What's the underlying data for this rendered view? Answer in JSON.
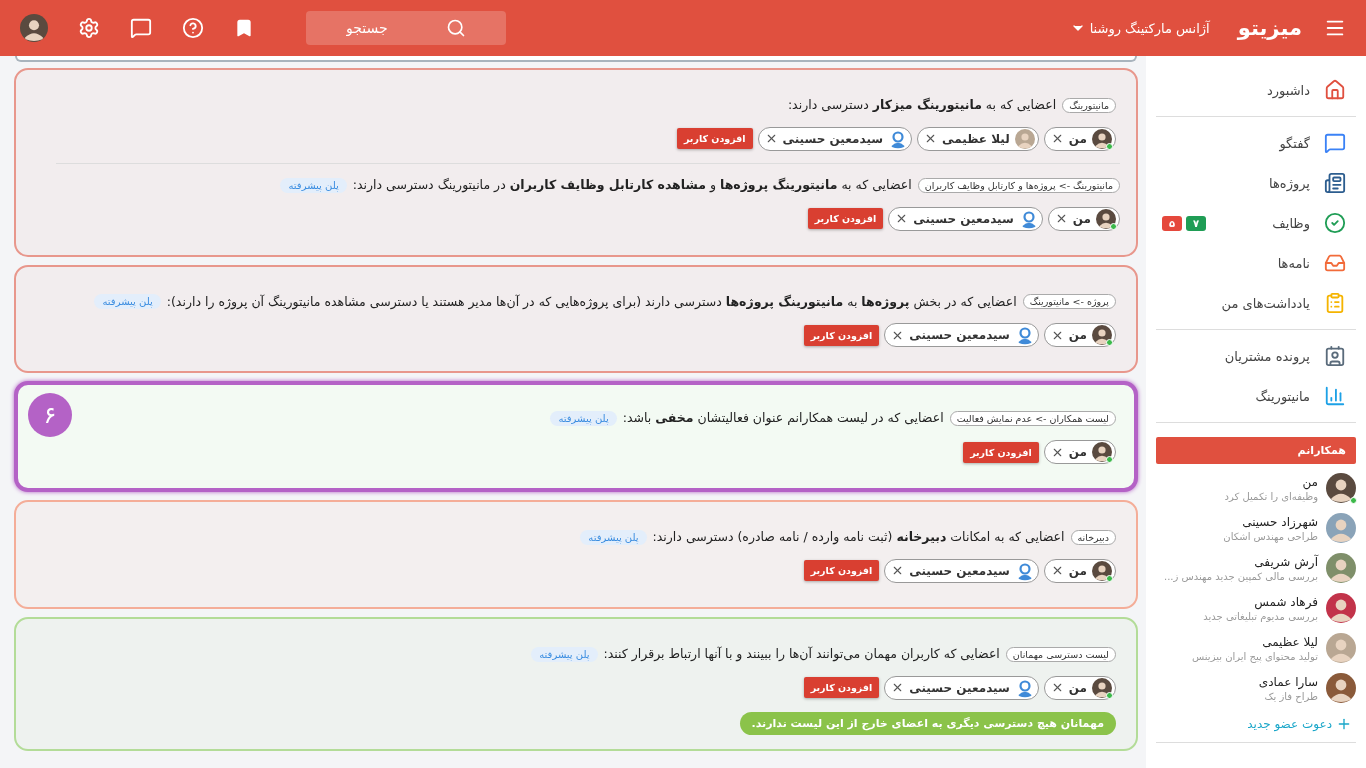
{
  "header": {
    "logo": "میزیتو",
    "workspace": "آژانس مارکتینگ روشنا",
    "search": {
      "placeholder": "جستجو"
    }
  },
  "cards": [
    {
      "color": "#e8978c",
      "selected": false,
      "sections": [
        {
          "tag": "مانیتورینگ",
          "text": "اعضایی که به **مانیتورینگ میزکار** دسترسی دارند:",
          "members": [
            {
              "name": "من",
              "kind": "photo",
              "online": true
            },
            {
              "name": "لیلا عظیمی",
              "kind": "photo",
              "online": false
            },
            {
              "name": "سیدمعین حسینی",
              "kind": "default",
              "online": false
            }
          ],
          "add": "افزودن کاربر"
        },
        {
          "tag": "مانیتورینگ -> پروژه‌ها و کارتابل وظایف کاربران",
          "text": "اعضایی که به **مانیتورینگ پروژه‌ها** و **مشاهده کارتابل وظایف کاربران** در مانیتورینگ دسترسی دارند:",
          "plan": "پلن پیشرفته",
          "members": [
            {
              "name": "من",
              "kind": "photo",
              "online": true
            },
            {
              "name": "سیدمعین حسینی",
              "kind": "default",
              "online": false
            }
          ],
          "add": "افزودن کاربر"
        }
      ]
    },
    {
      "color": "#e8978c",
      "selected": false,
      "sections": [
        {
          "tag": "پروژه -> مانیتورینگ",
          "text": "اعضایی که در بخش **پروژه‌ها** به **مانیتورینگ پروژه‌ها** دسترسی دارند (برای پروژه‌هایی که در آن‌ها مدیر هستند یا دسترسی مشاهده مانیتورینگ آن پروژه را دارند):",
          "plan": "پلن پیشرفته",
          "members": [
            {
              "name": "من",
              "kind": "photo",
              "online": true
            },
            {
              "name": "سیدمعین حسینی",
              "kind": "default",
              "online": false
            }
          ],
          "add": "افزودن کاربر"
        }
      ]
    },
    {
      "color": "#b462c6",
      "selected": true,
      "number": "۶",
      "sections": [
        {
          "tag": "لیست همکاران -> عدم نمایش فعالیت",
          "text": "اعضایی که در لیست همکارانم عنوان فعالیتشان **مخفی** باشد:",
          "plan": "پلن پیشرفته",
          "members": [
            {
              "name": "من",
              "kind": "photo",
              "online": true
            }
          ],
          "add": "افزودن کاربر"
        }
      ]
    },
    {
      "color": "#f4ad98",
      "selected": false,
      "sections": [
        {
          "tag": "دبیرخانه",
          "text": "اعضایی که به امکانات **دبیرخانه** (ثبت نامه وارده / نامه صادره) دسترسی دارند:",
          "plan": "پلن پیشرفته",
          "members": [
            {
              "name": "من",
              "kind": "photo",
              "online": true
            },
            {
              "name": "سیدمعین حسینی",
              "kind": "default",
              "online": false
            }
          ],
          "add": "افزودن کاربر"
        }
      ]
    },
    {
      "color": "#b3dc98",
      "selected": false,
      "sections": [
        {
          "tag": "لیست دسترسی مهمانان",
          "text": "اعضایی که کاربران مهمان می‌توانند آن‌ها را ببینند و با آنها ارتباط برقرار کنند:",
          "plan": "پلن پیشرفته",
          "members": [
            {
              "name": "من",
              "kind": "photo",
              "online": true
            },
            {
              "name": "سیدمعین حسینی",
              "kind": "default",
              "online": false
            }
          ],
          "add": "افزودن کاربر"
        }
      ],
      "note": "مهمانان هیچ دسترسی دیگری به اعضای خارج از این لیست ندارند."
    }
  ],
  "sidebar": {
    "groups": [
      [
        {
          "label": "داشبورد"
        }
      ],
      [
        {
          "label": "گفتگو"
        },
        {
          "label": "پروژه‌ها"
        },
        {
          "label": "وظایف",
          "badges": [
            {
              "text": "۷",
              "color": "#1f9d55"
            },
            {
              "text": "۵",
              "color": "#e5483c"
            }
          ]
        },
        {
          "label": "نامه‌ها"
        },
        {
          "label": "یادداشت‌های من"
        }
      ],
      [
        {
          "label": "پرونده مشتریان"
        },
        {
          "label": "مانیتورینگ"
        }
      ]
    ],
    "colleagues": {
      "title": "همکارانم",
      "people": [
        {
          "name": "من",
          "status": "وظیفه‌ای را تکمیل کرد",
          "online": true
        },
        {
          "name": "شهرزاد حسینی",
          "status": "طراحی مهندس اشکان",
          "online": false
        },
        {
          "name": "آرش شریفی",
          "status": "بررسی مالی کمپین جدید مهندس ز...",
          "online": false
        },
        {
          "name": "فرهاد شمس",
          "status": "بررسی مدیوم تبلیغاتی جدید",
          "online": false
        },
        {
          "name": "لیلا عظیمی",
          "status": "تولید محتوای پیج ایران بیزینس",
          "online": false
        },
        {
          "name": "سارا عمادی",
          "status": "طراح فاز یک",
          "online": false
        }
      ],
      "invite": "دعوت عضو جدید"
    }
  }
}
